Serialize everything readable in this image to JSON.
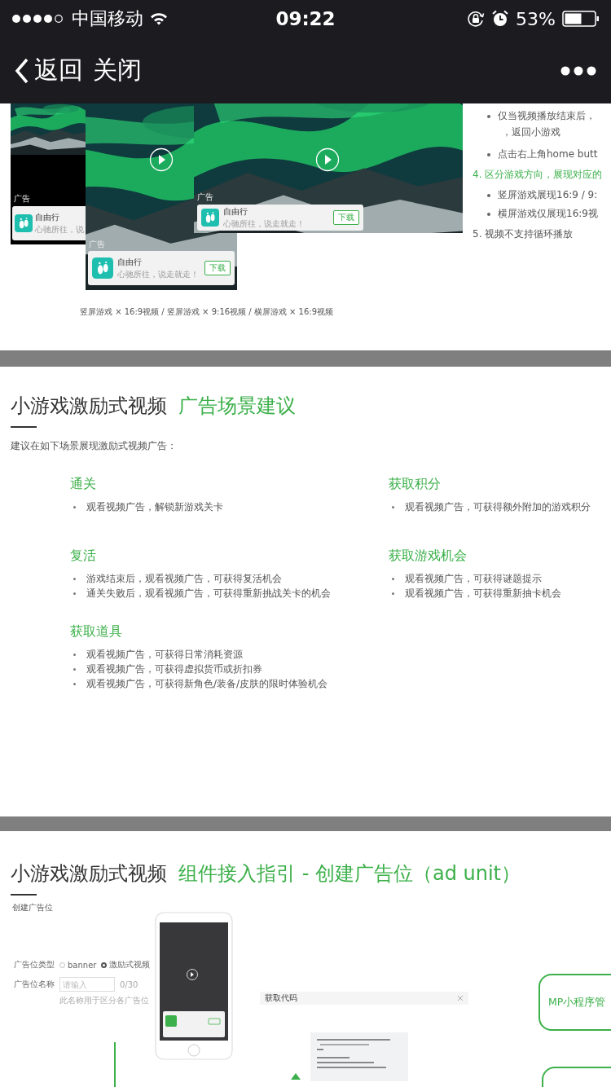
{
  "status_bar": {
    "carrier": "中国移动",
    "time": "09:22",
    "battery": "53%"
  },
  "nav": {
    "back": "返回",
    "close": "关闭"
  },
  "slide_1": {
    "screens": [
      {
        "ad_label": "广告",
        "name": "自由行",
        "slogan": "心驰所往，说"
      },
      {
        "ad_label": "广告",
        "name": "自由行",
        "slogan": "心驰所往，说走就走！",
        "button": "下载"
      },
      {
        "ad_label": "广告",
        "name": "自由行",
        "slogan": "心驰所往，说走就走！",
        "button": "下载"
      }
    ],
    "caption": "竖屏游戏 × 16:9视频 / 竖屏游戏 × 9:16视频 / 横屏游戏 × 16:9视频",
    "notes": [
      {
        "kind": "bullet",
        "text": "仅当视频播放结束后，"
      },
      {
        "kind": "continuation",
        "text": "，返回小游戏"
      },
      {
        "kind": "bullet",
        "text": "点击右上角home butt"
      },
      {
        "kind": "numbered",
        "number": "4.",
        "text": "区分游戏方向，展现对应的",
        "highlight": true
      },
      {
        "kind": "bullet",
        "text": "竖屏游戏展现16:9 / 9:"
      },
      {
        "kind": "bullet",
        "text": "横屏游戏仅展现16:9视"
      },
      {
        "kind": "numbered",
        "number": "5.",
        "text": "视频不支持循环播放",
        "highlight": false
      }
    ]
  },
  "slide_2": {
    "title": "小游戏激励式视频",
    "accent": "广告场景建议",
    "intro": "建议在如下场景展现激励式视频广告：",
    "scenes": [
      {
        "title": "通关",
        "bullets": [
          "观看视频广告，解锁新游戏关卡"
        ]
      },
      {
        "title": "获取积分",
        "bullets": [
          "观看视频广告，可获得额外附加的游戏积分"
        ]
      },
      {
        "title": "复活",
        "bullets": [
          "游戏结束后，观看视频广告，可获得复活机会",
          "通关失败后，观看视频广告，可获得重新挑战关卡的机会"
        ]
      },
      {
        "title": "获取游戏机会",
        "bullets": [
          "观看视频广告，可获得谜题提示",
          "观看视频广告，可获得重新抽卡机会"
        ]
      },
      {
        "title": "获取道具",
        "bullets": [
          "观看视频广告，可获得日常消耗资源",
          "观看视频广告，可获得虚拟货币或折扣券",
          "观看视频广告，可获得新角色/装备/皮肤的限时体验机会"
        ]
      }
    ]
  },
  "slide_3": {
    "title": "小游戏激励式视频",
    "accent": "组件接入指引 - 创建广告位（ad unit）",
    "section_label": "创建广告位",
    "form": {
      "type_label": "广告位类型",
      "options": [
        {
          "label": "banner",
          "selected": false
        },
        {
          "label": "激励式视频",
          "selected": true
        }
      ],
      "name_label": "广告位名称",
      "placeholder": "请输入",
      "counter": "0/30",
      "hint": "此名称用于区分各广告位"
    },
    "dialog": {
      "title": "获取代码"
    },
    "flow_box": "MP小程序管"
  }
}
